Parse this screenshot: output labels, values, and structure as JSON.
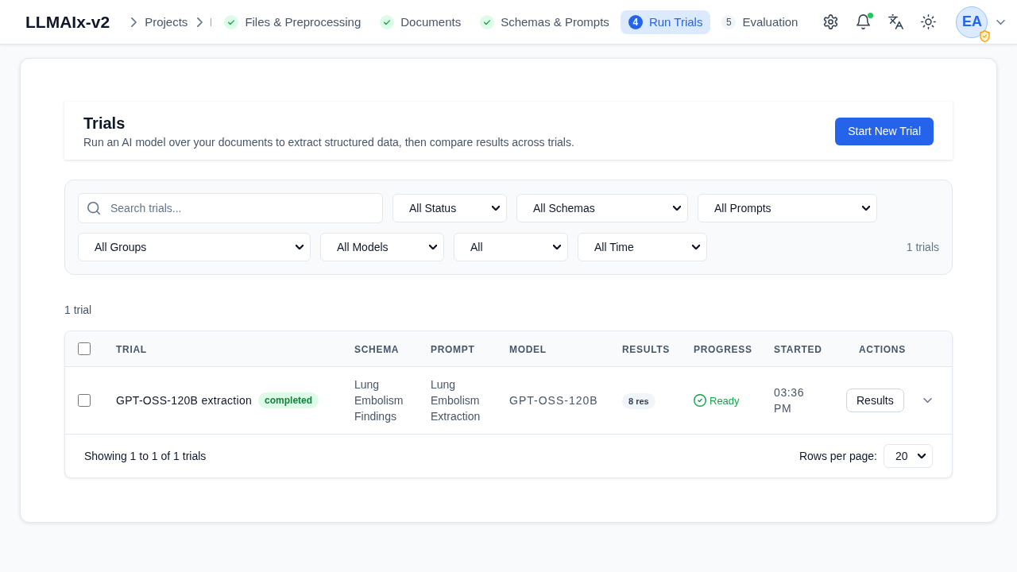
{
  "header": {
    "logo": "LLMAIx-v2",
    "breadcrumb": [
      {
        "label": "Projects"
      }
    ],
    "steps": [
      {
        "label": "Files & Preprocessing",
        "done": true,
        "selected": false
      },
      {
        "label": "Documents",
        "done": true,
        "selected": false
      },
      {
        "label": "Schemas & Prompts",
        "done": true,
        "selected": false
      },
      {
        "label": "Run Trials",
        "number": "4",
        "done": false,
        "selected": true
      },
      {
        "label": "Evaluation",
        "number": "5",
        "done": false,
        "selected": false
      }
    ],
    "notifications": {
      "unread": true
    },
    "user": {
      "initials": "EA",
      "verified": true
    }
  },
  "trials_panel": {
    "title": "Trials",
    "description": "Run an AI model over your documents to extract structured data, then compare results across trials.",
    "button": "Start New Trial"
  },
  "filters": {
    "search": {
      "placeholder": "Search trials..."
    },
    "dropdowns": [
      {
        "value": "All Status"
      },
      {
        "value": "All Schemas"
      },
      {
        "value": "All Prompts"
      },
      {
        "value": "All Groups"
      },
      {
        "value": "All Models"
      },
      {
        "value": "All"
      },
      {
        "value": "All Time"
      }
    ],
    "count": "1 trials"
  },
  "result_count": "1 trial",
  "table": {
    "select_all_checked": false,
    "columns": [
      "TRIAL",
      "SCHEMA",
      "PROMPT",
      "MODEL",
      "RESULTS",
      "PROGRESS",
      "STARTED",
      "ACTIONS"
    ],
    "rows": [
      {
        "checked": false,
        "name": "GPT-OSS-120B extraction",
        "status": "completed",
        "schema": "Lung Embolism Findings",
        "prompt": "Lung Embolism Extraction",
        "model": "GPT-OSS-120B",
        "results": "8 res",
        "progress": "Ready",
        "started": "03:36 PM",
        "action": "Results",
        "expanded": false
      }
    ],
    "footer": {
      "summary": "Showing 1 to 1 of 1 trials",
      "rows_per_page_label": "Rows per page:",
      "rows_per_page": "20"
    }
  }
}
